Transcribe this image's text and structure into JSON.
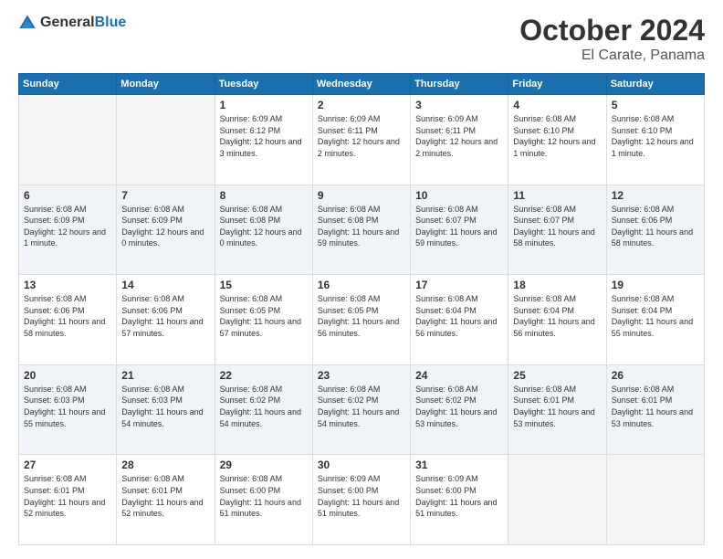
{
  "header": {
    "logo_general": "General",
    "logo_blue": "Blue",
    "month": "October 2024",
    "location": "El Carate, Panama"
  },
  "weekdays": [
    "Sunday",
    "Monday",
    "Tuesday",
    "Wednesday",
    "Thursday",
    "Friday",
    "Saturday"
  ],
  "weeks": [
    [
      {
        "day": "",
        "info": ""
      },
      {
        "day": "",
        "info": ""
      },
      {
        "day": "1",
        "info": "Sunrise: 6:09 AM\nSunset: 6:12 PM\nDaylight: 12 hours and 3 minutes."
      },
      {
        "day": "2",
        "info": "Sunrise: 6:09 AM\nSunset: 6:11 PM\nDaylight: 12 hours and 2 minutes."
      },
      {
        "day": "3",
        "info": "Sunrise: 6:09 AM\nSunset: 6:11 PM\nDaylight: 12 hours and 2 minutes."
      },
      {
        "day": "4",
        "info": "Sunrise: 6:08 AM\nSunset: 6:10 PM\nDaylight: 12 hours and 1 minute."
      },
      {
        "day": "5",
        "info": "Sunrise: 6:08 AM\nSunset: 6:10 PM\nDaylight: 12 hours and 1 minute."
      }
    ],
    [
      {
        "day": "6",
        "info": "Sunrise: 6:08 AM\nSunset: 6:09 PM\nDaylight: 12 hours and 1 minute."
      },
      {
        "day": "7",
        "info": "Sunrise: 6:08 AM\nSunset: 6:09 PM\nDaylight: 12 hours and 0 minutes."
      },
      {
        "day": "8",
        "info": "Sunrise: 6:08 AM\nSunset: 6:08 PM\nDaylight: 12 hours and 0 minutes."
      },
      {
        "day": "9",
        "info": "Sunrise: 6:08 AM\nSunset: 6:08 PM\nDaylight: 11 hours and 59 minutes."
      },
      {
        "day": "10",
        "info": "Sunrise: 6:08 AM\nSunset: 6:07 PM\nDaylight: 11 hours and 59 minutes."
      },
      {
        "day": "11",
        "info": "Sunrise: 6:08 AM\nSunset: 6:07 PM\nDaylight: 11 hours and 58 minutes."
      },
      {
        "day": "12",
        "info": "Sunrise: 6:08 AM\nSunset: 6:06 PM\nDaylight: 11 hours and 58 minutes."
      }
    ],
    [
      {
        "day": "13",
        "info": "Sunrise: 6:08 AM\nSunset: 6:06 PM\nDaylight: 11 hours and 58 minutes."
      },
      {
        "day": "14",
        "info": "Sunrise: 6:08 AM\nSunset: 6:06 PM\nDaylight: 11 hours and 57 minutes."
      },
      {
        "day": "15",
        "info": "Sunrise: 6:08 AM\nSunset: 6:05 PM\nDaylight: 11 hours and 57 minutes."
      },
      {
        "day": "16",
        "info": "Sunrise: 6:08 AM\nSunset: 6:05 PM\nDaylight: 11 hours and 56 minutes."
      },
      {
        "day": "17",
        "info": "Sunrise: 6:08 AM\nSunset: 6:04 PM\nDaylight: 11 hours and 56 minutes."
      },
      {
        "day": "18",
        "info": "Sunrise: 6:08 AM\nSunset: 6:04 PM\nDaylight: 11 hours and 56 minutes."
      },
      {
        "day": "19",
        "info": "Sunrise: 6:08 AM\nSunset: 6:04 PM\nDaylight: 11 hours and 55 minutes."
      }
    ],
    [
      {
        "day": "20",
        "info": "Sunrise: 6:08 AM\nSunset: 6:03 PM\nDaylight: 11 hours and 55 minutes."
      },
      {
        "day": "21",
        "info": "Sunrise: 6:08 AM\nSunset: 6:03 PM\nDaylight: 11 hours and 54 minutes."
      },
      {
        "day": "22",
        "info": "Sunrise: 6:08 AM\nSunset: 6:02 PM\nDaylight: 11 hours and 54 minutes."
      },
      {
        "day": "23",
        "info": "Sunrise: 6:08 AM\nSunset: 6:02 PM\nDaylight: 11 hours and 54 minutes."
      },
      {
        "day": "24",
        "info": "Sunrise: 6:08 AM\nSunset: 6:02 PM\nDaylight: 11 hours and 53 minutes."
      },
      {
        "day": "25",
        "info": "Sunrise: 6:08 AM\nSunset: 6:01 PM\nDaylight: 11 hours and 53 minutes."
      },
      {
        "day": "26",
        "info": "Sunrise: 6:08 AM\nSunset: 6:01 PM\nDaylight: 11 hours and 53 minutes."
      }
    ],
    [
      {
        "day": "27",
        "info": "Sunrise: 6:08 AM\nSunset: 6:01 PM\nDaylight: 11 hours and 52 minutes."
      },
      {
        "day": "28",
        "info": "Sunrise: 6:08 AM\nSunset: 6:01 PM\nDaylight: 11 hours and 52 minutes."
      },
      {
        "day": "29",
        "info": "Sunrise: 6:08 AM\nSunset: 6:00 PM\nDaylight: 11 hours and 51 minutes."
      },
      {
        "day": "30",
        "info": "Sunrise: 6:09 AM\nSunset: 6:00 PM\nDaylight: 11 hours and 51 minutes."
      },
      {
        "day": "31",
        "info": "Sunrise: 6:09 AM\nSunset: 6:00 PM\nDaylight: 11 hours and 51 minutes."
      },
      {
        "day": "",
        "info": ""
      },
      {
        "day": "",
        "info": ""
      }
    ]
  ]
}
